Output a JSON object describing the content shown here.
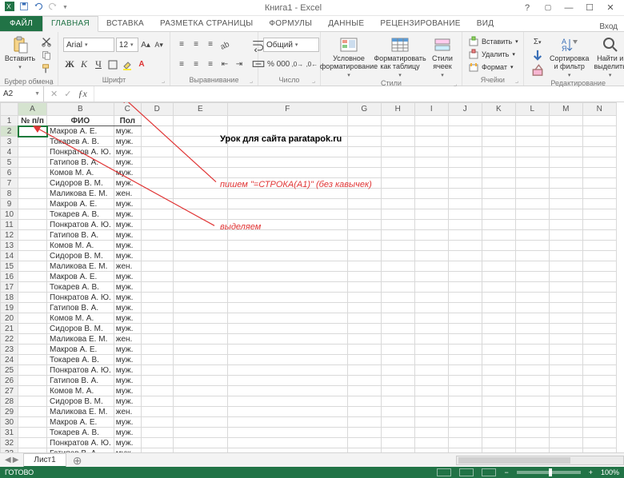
{
  "app": {
    "title": "Книга1 - Excel",
    "login": "Вход"
  },
  "tabs": {
    "file": "ФАЙЛ",
    "items": [
      "ГЛАВНАЯ",
      "ВСТАВКА",
      "РАЗМЕТКА СТРАНИЦЫ",
      "ФОРМУЛЫ",
      "ДАННЫЕ",
      "РЕЦЕНЗИРОВАНИЕ",
      "ВИД"
    ],
    "active": 0
  },
  "ribbon": {
    "clipboard": {
      "label": "Буфер обмена",
      "paste": "Вставить"
    },
    "font": {
      "label": "Шрифт",
      "name": "Arial",
      "size": "12"
    },
    "alignment": {
      "label": "Выравнивание"
    },
    "number": {
      "label": "Число",
      "format": "Общий"
    },
    "styles": {
      "label": "Стили",
      "cond": "Условное форматирование",
      "table": "Форматировать как таблицу",
      "cell": "Стили ячеек"
    },
    "cells": {
      "label": "Ячейки",
      "insert": "Вставить",
      "delete": "Удалить",
      "format": "Формат"
    },
    "editing": {
      "label": "Редактирование",
      "sort": "Сортировка и фильтр",
      "find": "Найти и выделить"
    }
  },
  "namebox": "A2",
  "columns": [
    "A",
    "B",
    "C",
    "D",
    "E",
    "F",
    "G",
    "H",
    "I",
    "J",
    "K",
    "L",
    "M",
    "N"
  ],
  "headers": {
    "a": "№ п/п",
    "b": "ФИО",
    "c": "Пол"
  },
  "rows": [
    {
      "b": "Макров А. Е.",
      "c": "муж."
    },
    {
      "b": "Токарев А. В.",
      "c": "муж."
    },
    {
      "b": "Понкратов А. Ю.",
      "c": "муж."
    },
    {
      "b": "Гатипов В. А.",
      "c": "муж."
    },
    {
      "b": "Комов М. А.",
      "c": "муж."
    },
    {
      "b": "Сидоров В. М.",
      "c": "муж."
    },
    {
      "b": "Маликова Е. М.",
      "c": "жен."
    },
    {
      "b": "Макров А. Е.",
      "c": "муж."
    },
    {
      "b": "Токарев А. В.",
      "c": "муж."
    },
    {
      "b": "Понкратов А. Ю.",
      "c": "муж."
    },
    {
      "b": "Гатипов В. А.",
      "c": "муж."
    },
    {
      "b": "Комов М. А.",
      "c": "муж."
    },
    {
      "b": "Сидоров В. М.",
      "c": "муж."
    },
    {
      "b": "Маликова Е. М.",
      "c": "жен."
    },
    {
      "b": "Макров А. Е.",
      "c": "муж."
    },
    {
      "b": "Токарев А. В.",
      "c": "муж."
    },
    {
      "b": "Понкратов А. Ю.",
      "c": "муж."
    },
    {
      "b": "Гатипов В. А.",
      "c": "муж."
    },
    {
      "b": "Комов М. А.",
      "c": "муж."
    },
    {
      "b": "Сидоров В. М.",
      "c": "муж."
    },
    {
      "b": "Маликова Е. М.",
      "c": "жен."
    },
    {
      "b": "Макров А. Е.",
      "c": "муж."
    },
    {
      "b": "Токарев А. В.",
      "c": "муж."
    },
    {
      "b": "Понкратов А. Ю.",
      "c": "муж."
    },
    {
      "b": "Гатипов В. А.",
      "c": "муж."
    },
    {
      "b": "Комов М. А.",
      "c": "муж."
    },
    {
      "b": "Сидоров В. М.",
      "c": "муж."
    },
    {
      "b": "Маликова Е. М.",
      "c": "жен."
    },
    {
      "b": "Макров А. Е.",
      "c": "муж."
    },
    {
      "b": "Токарев А. В.",
      "c": "муж."
    },
    {
      "b": "Понкратов А. Ю.",
      "c": "муж."
    },
    {
      "b": "Гатипов В. А.",
      "c": "муж."
    }
  ],
  "annotations": {
    "lesson": "Урок для сайта paratapok.ru",
    "formula": "пишем \"=СТРОКА(A1)\"  (без кавычек)",
    "select": "выделяем"
  },
  "sheettab": "Лист1",
  "status": {
    "ready": "ГОТОВО",
    "zoom": "100%"
  }
}
